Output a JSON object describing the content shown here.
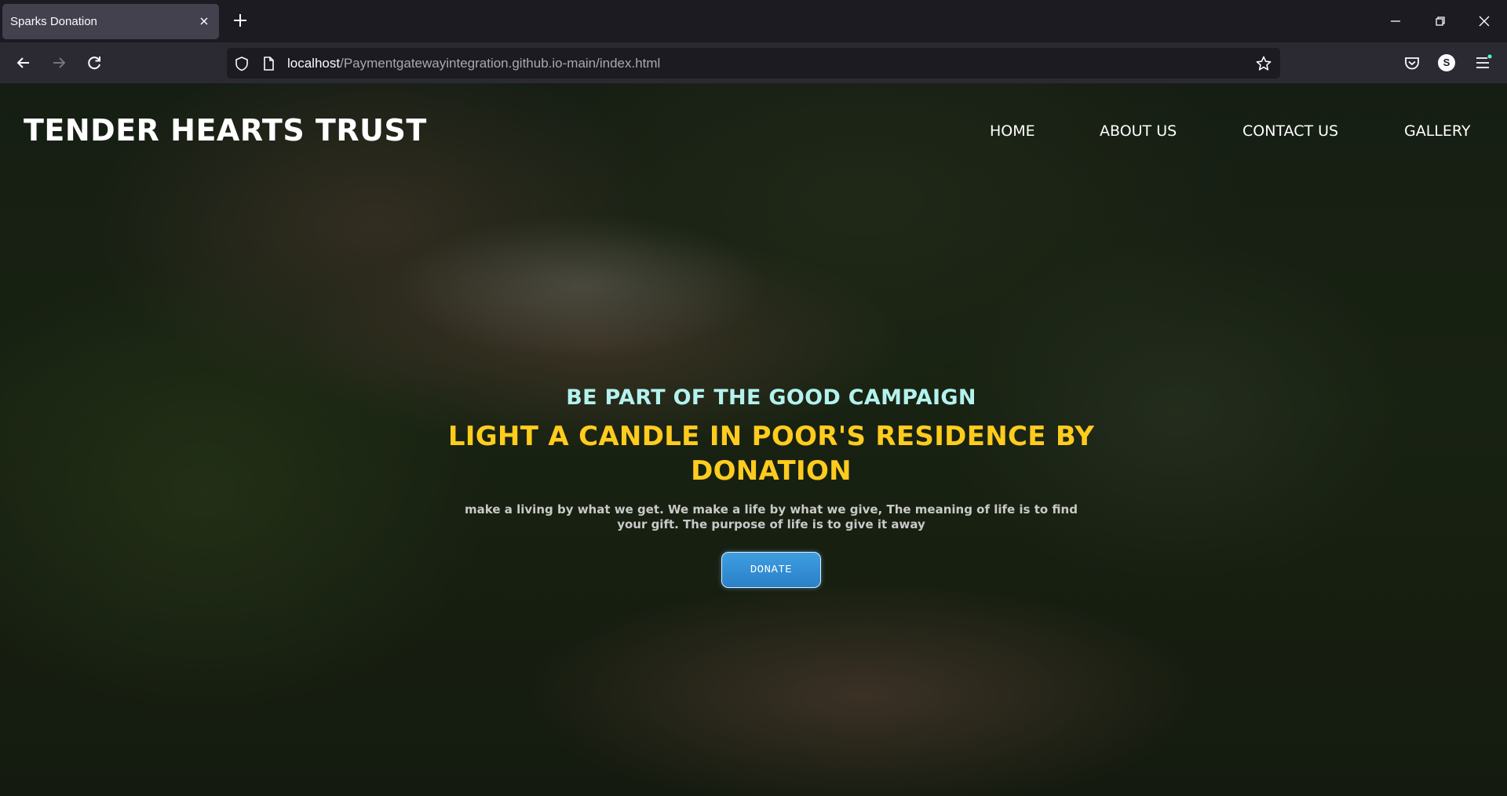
{
  "browser": {
    "tab_title": "Sparks Donation",
    "url_host": "localhost",
    "url_path": "/Paymentgatewayintegration.github.io-main/index.html",
    "profile_initial": "S"
  },
  "site": {
    "logo": "TENDER HEARTS TRUST",
    "nav": [
      {
        "label": "HOME"
      },
      {
        "label": "ABOUT US"
      },
      {
        "label": "CONTACT US"
      },
      {
        "label": "GALLERY"
      }
    ]
  },
  "hero": {
    "subtitle": "BE PART OF THE GOOD CAMPAIGN",
    "title": "LIGHT A CANDLE IN POOR'S RESIDENCE BY DONATION",
    "text": "make a living by what we get. We make a life by what we give, The meaning of life is to find your gift. The purpose of life is to give it away",
    "button_label": "DONATE"
  },
  "colors": {
    "subtitle": "#b3f2ee",
    "title": "#ffcc1e",
    "button": "#2f8ed6"
  }
}
